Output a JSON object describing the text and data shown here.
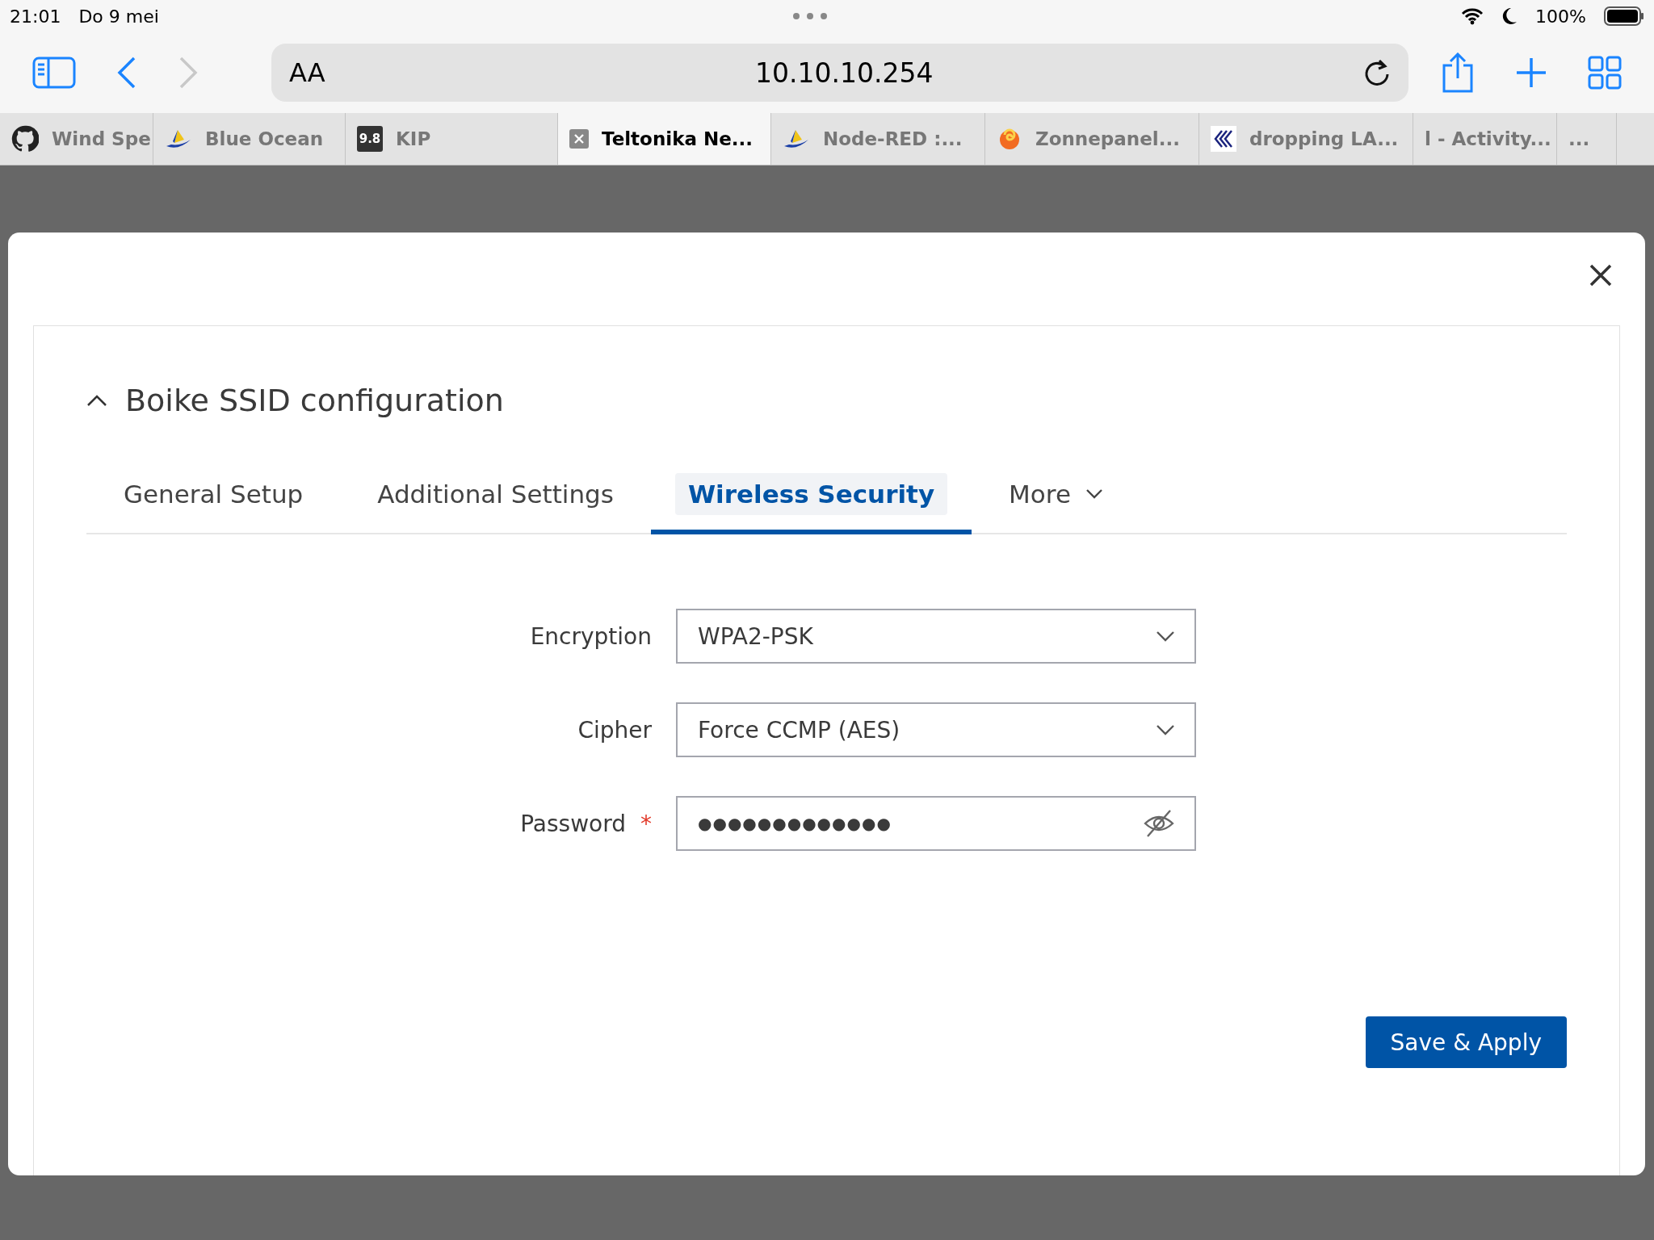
{
  "status_bar": {
    "time": "21:01",
    "date": "Do 9 mei",
    "battery": "100%"
  },
  "toolbar": {
    "reader_label": "AA",
    "url": "10.10.10.254",
    "back_disabled": false,
    "forward_disabled": true
  },
  "browser_tabs": [
    {
      "title": "Wind Spe",
      "kind": "github",
      "selected": false
    },
    {
      "title": "Blue Ocean",
      "kind": "boat",
      "selected": false
    },
    {
      "title": "KIP",
      "kind": "speed",
      "icon_text": "9.8",
      "selected": false
    },
    {
      "title": "Teltonika Ne...",
      "kind": "closebox",
      "selected": true
    },
    {
      "title": "Node-RED :...",
      "kind": "boat",
      "selected": false
    },
    {
      "title": "Zonnepanel...",
      "kind": "spiral",
      "selected": false
    },
    {
      "title": "dropping LA...",
      "kind": "chevrons",
      "selected": false
    },
    {
      "title": "l - Activity...",
      "kind": "none",
      "selected": false
    },
    {
      "title": "...",
      "kind": "none",
      "selected": false
    }
  ],
  "modal": {
    "title": "Boike SSID configuration",
    "expanded": true,
    "tabs": [
      {
        "label": "General Setup",
        "selected": false,
        "dropdown": false
      },
      {
        "label": "Additional Settings",
        "selected": false,
        "dropdown": false
      },
      {
        "label": "Wireless Security",
        "selected": true,
        "dropdown": false
      },
      {
        "label": "More",
        "selected": false,
        "dropdown": true
      }
    ],
    "fields": [
      {
        "label": "Encryption",
        "kind": "select",
        "value": "WPA2-PSK",
        "required": false
      },
      {
        "label": "Cipher",
        "kind": "select",
        "value": "Force CCMP (AES)",
        "required": false
      },
      {
        "label": "Password",
        "kind": "password",
        "value": "●●●●●●●●●●●●●",
        "required": true,
        "required_mark": "*"
      }
    ],
    "save_button": "Save & Apply"
  }
}
